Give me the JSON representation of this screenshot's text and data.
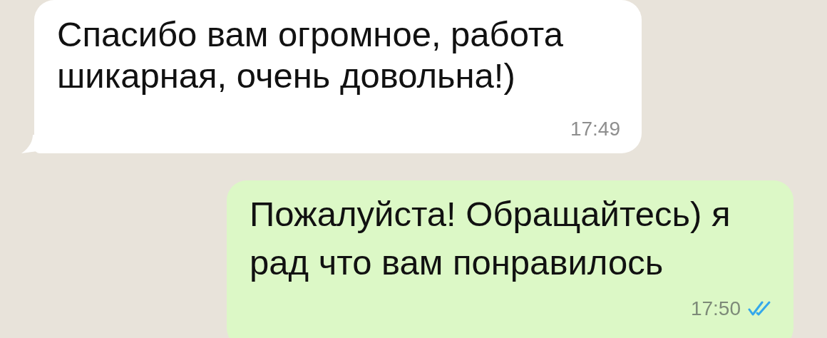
{
  "messages": [
    {
      "outgoing": false,
      "text": "Спасибо вам огромное, работа шикарная, очень довольна!)",
      "time": "17:49"
    },
    {
      "outgoing": true,
      "text": "Пожалуйста! Обращайтесь) я рад что вам понравилось",
      "time": "17:50",
      "read": true
    }
  ]
}
